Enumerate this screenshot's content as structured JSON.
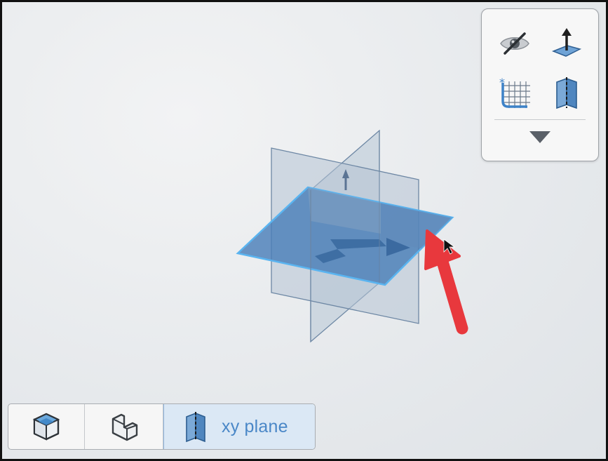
{
  "toolbar": {
    "buttons": [
      {
        "id": "hide",
        "icon": "eye-slash-icon"
      },
      {
        "id": "normal",
        "icon": "plane-normal-arrow-icon"
      },
      {
        "id": "grid",
        "icon": "sketch-grid-icon"
      },
      {
        "id": "plane",
        "icon": "plane-icon"
      }
    ],
    "more_icon": "triangle-down-icon"
  },
  "modebar": {
    "solid_icon": "solid-cube-icon",
    "sketch_icon": "sketch-part-icon",
    "plane_icon": "plane-icon",
    "plane_label": "xy plane"
  },
  "colors": {
    "plane_fill_selected": "#4a7fb8",
    "plane_highlight": "#5ab4f0",
    "plane_fill": "#b9c8d8",
    "arrow_red": "#e8383d",
    "accent_blue": "#4a87c7",
    "active_bg": "#dbe8f5"
  }
}
